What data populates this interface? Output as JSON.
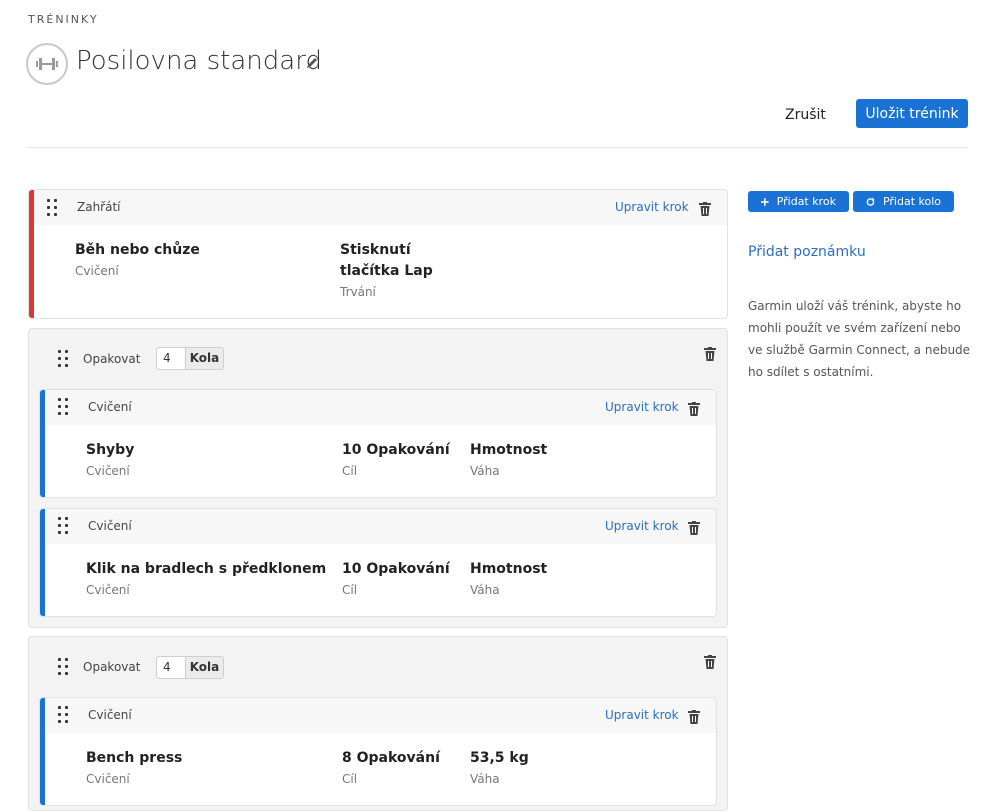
{
  "header": {
    "breadcrumb": "TRÉNINKY",
    "title": "Posilovna standard",
    "cancel_label": "Zrušit",
    "save_label": "Uložit trénink"
  },
  "sidebar": {
    "add_step_label": "Přidat krok",
    "add_round_label": "Přidat kolo",
    "add_note_label": "Přidat poznámku",
    "info_text": "Garmin uloží váš trénink, abyste ho mohli použít ve svém zařízení nebo ve službě Garmin Connect, a nebude ho sdílet s ostatními."
  },
  "colors": {
    "warmup": "#e03535",
    "exercise": "#1a73d4",
    "accent": "#1a73d4"
  },
  "warmup": {
    "label": "Zahřátí",
    "edit_label": "Upravit krok",
    "name": "Běh nebo chůze",
    "name_sub": "Cvičení",
    "duration_line1": "Stisknutí",
    "duration_line2": "tlačítka Lap",
    "duration_sub": "Trvání"
  },
  "repeats": [
    {
      "label": "Opakovat",
      "count": "4",
      "unit": "Kola",
      "steps": [
        {
          "label": "Cvičení",
          "edit_label": "Upravit krok",
          "name": "Shyby",
          "name_sub": "Cvičení",
          "target": "10 Opakování",
          "target_sub": "Cíl",
          "weight": "Hmotnost",
          "weight_sub": "Váha"
        },
        {
          "label": "Cvičení",
          "edit_label": "Upravit krok",
          "name": "Klik na bradlech s předklonem",
          "name_sub": "Cvičení",
          "target": "10 Opakování",
          "target_sub": "Cíl",
          "weight": "Hmotnost",
          "weight_sub": "Váha"
        }
      ]
    },
    {
      "label": "Opakovat",
      "count": "4",
      "unit": "Kola",
      "steps": [
        {
          "label": "Cvičení",
          "edit_label": "Upravit krok",
          "name": "Bench press",
          "name_sub": "Cvičení",
          "target": "8 Opakování",
          "target_sub": "Cíl",
          "weight": "53,5 kg",
          "weight_sub": "Váha"
        }
      ]
    }
  ]
}
